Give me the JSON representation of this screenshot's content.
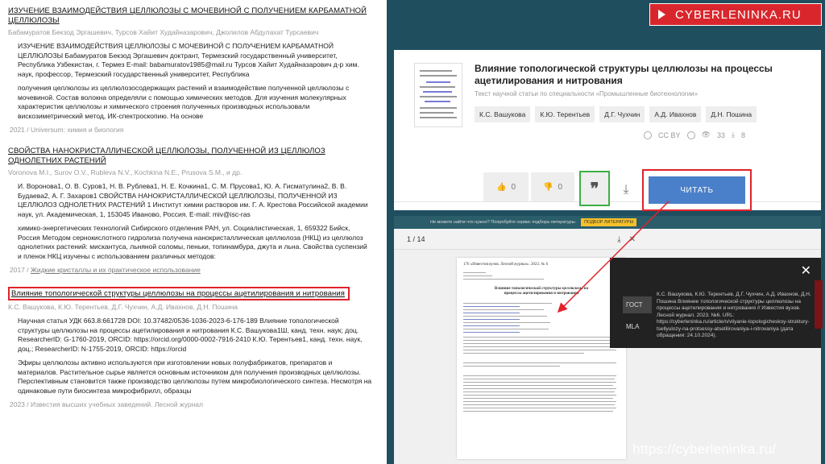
{
  "results": [
    {
      "title": "ИЗУЧЕНИЕ ВЗАИМОДЕЙСТВИЯ ЦЕЛЛЮЛОЗЫ С МОЧЕВИНОЙ С ПОЛУЧЕНИЕМ КАРБАМАТНОЙ ЦЕЛЛЮЛОЗЫ",
      "authors": "Бабамуратов Бекзод Эргашевич, Турсов Хайит Худайназарович, Джолилов Абдулахат Турсаевич",
      "para1": "ИЗУЧЕНИЕ ВЗАИМОДЕЙСТВИЯ ЦЕЛЛЮЛОЗЫ С МОЧЕВИНОЙ С ПОЛУЧЕНИЕМ КАРБАМАТНОЙ ЦЕЛЛЮЛОЗЫ Бабамуратов Бекзод Эргашевич доктрант, Термезский государственный университет, Республика Узбекистан, г. Термез E-mail: babamuratov1985@mail.ru Турсов Хайит Худайназарович д-р хим. наук, профессор, Термезский государственный университет, Республика",
      "para2": "получения целлюлозы из целлюлозосодержащих растений и взаимодействие полученной целлюлозы с мочевиной. Состав волокна определяли с помощью химических методов. Для изучения молекулярных характеристик целлюлозы и химического строения полученных производных использовали вискозиметрический метод, ИК-спектроскопию. На основе",
      "meta": "2021 / Universum: химия и биология"
    },
    {
      "title": "СВОЙСТВА НАНОКРИСТАЛЛИЧЕСКОЙ ЦЕЛЛЮЛОЗЫ, ПОЛУЧЕННОЙ ИЗ ЦЕЛЛЮЛОЗ ОДНОЛЕТНИХ РАСТЕНИЙ",
      "authors": "Voronova M.I., Surov O.V., Rubleva N.V., Kochkina N.E., Prusova S.M., и др.",
      "para1": "И. Воронова1, О. В. Суров1, Н. В. Рублева1, Н. Е. Кочкина1, С. М. Прусова1, Ю. А. Гисматулина2, В. В. Будаева2, А. Г. Захаров1 СВОЙСТВА НАНОКРИСТАЛЛИЧЕСКОЙ ЦЕЛЛЮЛОЗЫ, ПОЛУЧЕННОЙ ИЗ ЦЕЛЛЮЛОЗ ОДНОЛЕТНИХ РАСТЕНИЙ 1 Институт химии растворов им. Г. А. Крестова Российской академии наук, ул. Академическая, 1, 153045 Иваново, Россия. E-mail: miv@isc-ras",
      "para2": "химико-энергетических технологий Сибирского отделения РАН, ул. Социалистическая, 1, 659322 Бийск, Россия Методом сернокислотного гидролиза получена нанокристаллическая целлюлоза (НКЦ) из целлюлоз однолетних растений: мискантуса, льняной соломы, пеньки, топинамбура, джута и льна. Свойства суспензий и пленок НКЦ изучены с использованием различных методов:",
      "meta": "2017 / ",
      "meta_link": "Жидкие кристаллы и их практическое использование"
    },
    {
      "title": "Влияние топологической структуры целлюлозы на процессы ацетилирования и нитрования",
      "authors": "К.С. Вашукова, К.Ю. Терентьев, Д.Г. Чухчин, А.Д. Ивахнов, Д.Н. Пошина",
      "para1": "Научная статья УДК 663.8:661728 DOI: 10.37482/0536-1036-2023-6-176-189 Влияние топологической структуры целлюлозы на процессы ацетилирования и нитрования К.С. Вашукова1Ш, канд. техн. наук; доц. ResearcherID: G-1760-2019, ORCID: https://orcid.org/0000-0002-7916-2410 К.Ю. Терентьев1, канд. техн. наук, доц.; ResearcherID: N-1755-2019, ORCID: https://orcid",
      "para2": "Эфиры целлюлозы активно используются при изготовлении новых полуфабрикатов, препаратов и материалов. Растительное сырье является основным источником для получения производных целлюлозы. Перспективным становится также производство целлюлозы путем микробиологического синтеза. Несмотря на одинаковые пути биосинтеза микрофибрилл, образцы",
      "meta": "2023 / Известия высших учебных заведений. Лесной журнал"
    }
  ],
  "badge": "CYBERLENINKA.RU",
  "article": {
    "title": "Влияние топологической структуры целлюлозы на процессы ацетилирования и нитрования",
    "subtitle": "Текст научной статьи по специальности «Промышленные биотехнологии»",
    "authors": [
      "К.С. Вашукова",
      "К.Ю. Терентьев",
      "Д.Г. Чухчин",
      "А.Д. Ивахнов",
      "Д.Н. Пошина"
    ],
    "license": "CC BY",
    "views": "33",
    "downloads": "8",
    "likes": "0",
    "dislikes": "0",
    "read_label": "ЧИТАТЬ"
  },
  "viewer": {
    "banner": "Не можете найти что нужно? Попробуйте сервис подбора литературы.",
    "banner_btn": "ПОДБОР ЛИТЕРАТУРЫ",
    "page_counter": "1 / 14",
    "page_header": "176    «Известия вузов. Лесной журнал». 2023. № 6",
    "page_title": "Влияние топологической структуры целлюлозы на процессы ацетилирования и нитрования"
  },
  "citation": {
    "tab_gost": "ГОСТ",
    "tab_mla": "MLA",
    "text": "К.С. Вашукова, К.Ю. Терентьев, Д.Г. Чухчин, А.Д. Ивахнов, Д.Н. Пошина Влияние топологической структуры целлюлозы на процессы ацетилирования и нитрования // Известия вузов. Лесной журнал. 2023. №6. URL: https://cyberleninka.ru/article/n/vliyanie-topologicheskoy-struktury-tsellyulozy-na-protsessy-atsetilirovaniya-i-nitrovaniya (дата обращения: 24.10.2024)."
  },
  "footer_url": "https://cyberleninka.ru/"
}
